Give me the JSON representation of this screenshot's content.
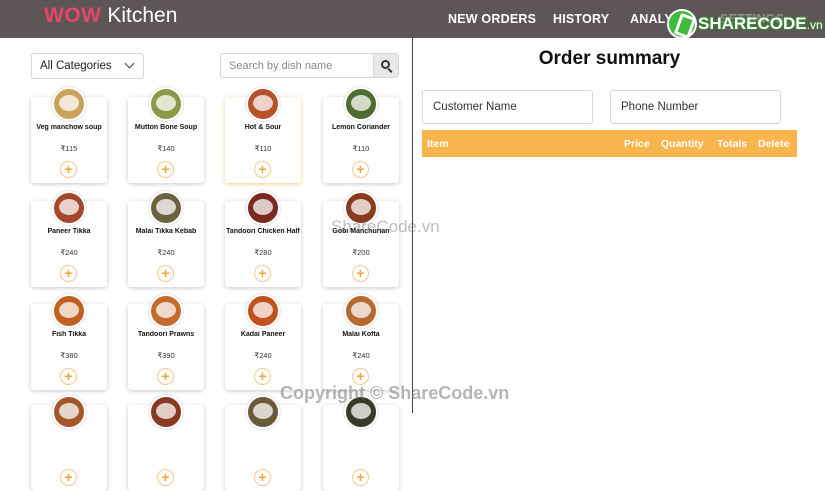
{
  "header": {
    "brand_wow": "WOW",
    "brand_name": "Kitchen",
    "nav": [
      {
        "label": "NEW ORDERS"
      },
      {
        "label": "HISTORY"
      },
      {
        "label": "ANALY"
      },
      {
        "label": "SETTINGS"
      }
    ],
    "watermark_logo": "SHARECODE",
    "watermark_logo_suffix": ".vn",
    "colors": {
      "bar": "#5e5656",
      "brand_accent": "#e8456a"
    }
  },
  "filters": {
    "category_value": "All Categories",
    "search_placeholder": "Search by dish name"
  },
  "dishes": [
    {
      "name": "Veg manchow soup",
      "price": "₹115",
      "swatch": "#c9a35a"
    },
    {
      "name": "Mutton Bone Soup",
      "price": "₹140",
      "swatch": "#8a9a4a"
    },
    {
      "name": "Hot & Sour",
      "price": "₹110",
      "swatch": "#b5522a",
      "active": true
    },
    {
      "name": "Lemon Coriander",
      "price": "₹110",
      "swatch": "#4f6b2f"
    },
    {
      "name": "Paneer Tikka",
      "price": "₹240",
      "swatch": "#a4472a"
    },
    {
      "name": "Malai Tikka Kebab",
      "price": "₹240",
      "swatch": "#6b6340"
    },
    {
      "name": "Tandoori Chicken Half",
      "price": "₹280",
      "swatch": "#7a2a1e"
    },
    {
      "name": "Gobi Manchurian",
      "price": "₹200",
      "swatch": "#8a3a1e"
    },
    {
      "name": "Fish Tikka",
      "price": "₹380",
      "swatch": "#c0611f"
    },
    {
      "name": "Tandoori Prawns",
      "price": "₹390",
      "swatch": "#c46a2a"
    },
    {
      "name": "Kadai Paneer",
      "price": "₹240",
      "swatch": "#c2521c"
    },
    {
      "name": "Malai Kofta",
      "price": "₹240",
      "swatch": "#b56a30"
    },
    {
      "name": "",
      "price": "",
      "swatch": "#a4572a"
    },
    {
      "name": "",
      "price": "",
      "swatch": "#8a3a24"
    },
    {
      "name": "",
      "price": "",
      "swatch": "#6b5a3a"
    },
    {
      "name": "",
      "price": "",
      "swatch": "#3a3a2a"
    }
  ],
  "order": {
    "title": "Order summary",
    "customer_placeholder": "Customer Name",
    "phone_placeholder": "Phone Number",
    "columns": {
      "item": "Item",
      "price": "Price",
      "quantity": "Quantity",
      "totals": "Totals",
      "delete": "Delete"
    },
    "header_color": "#f8b44d"
  },
  "watermarks": {
    "center": "ShareCode.vn",
    "bottom": "Copyright © ShareCode.vn"
  }
}
